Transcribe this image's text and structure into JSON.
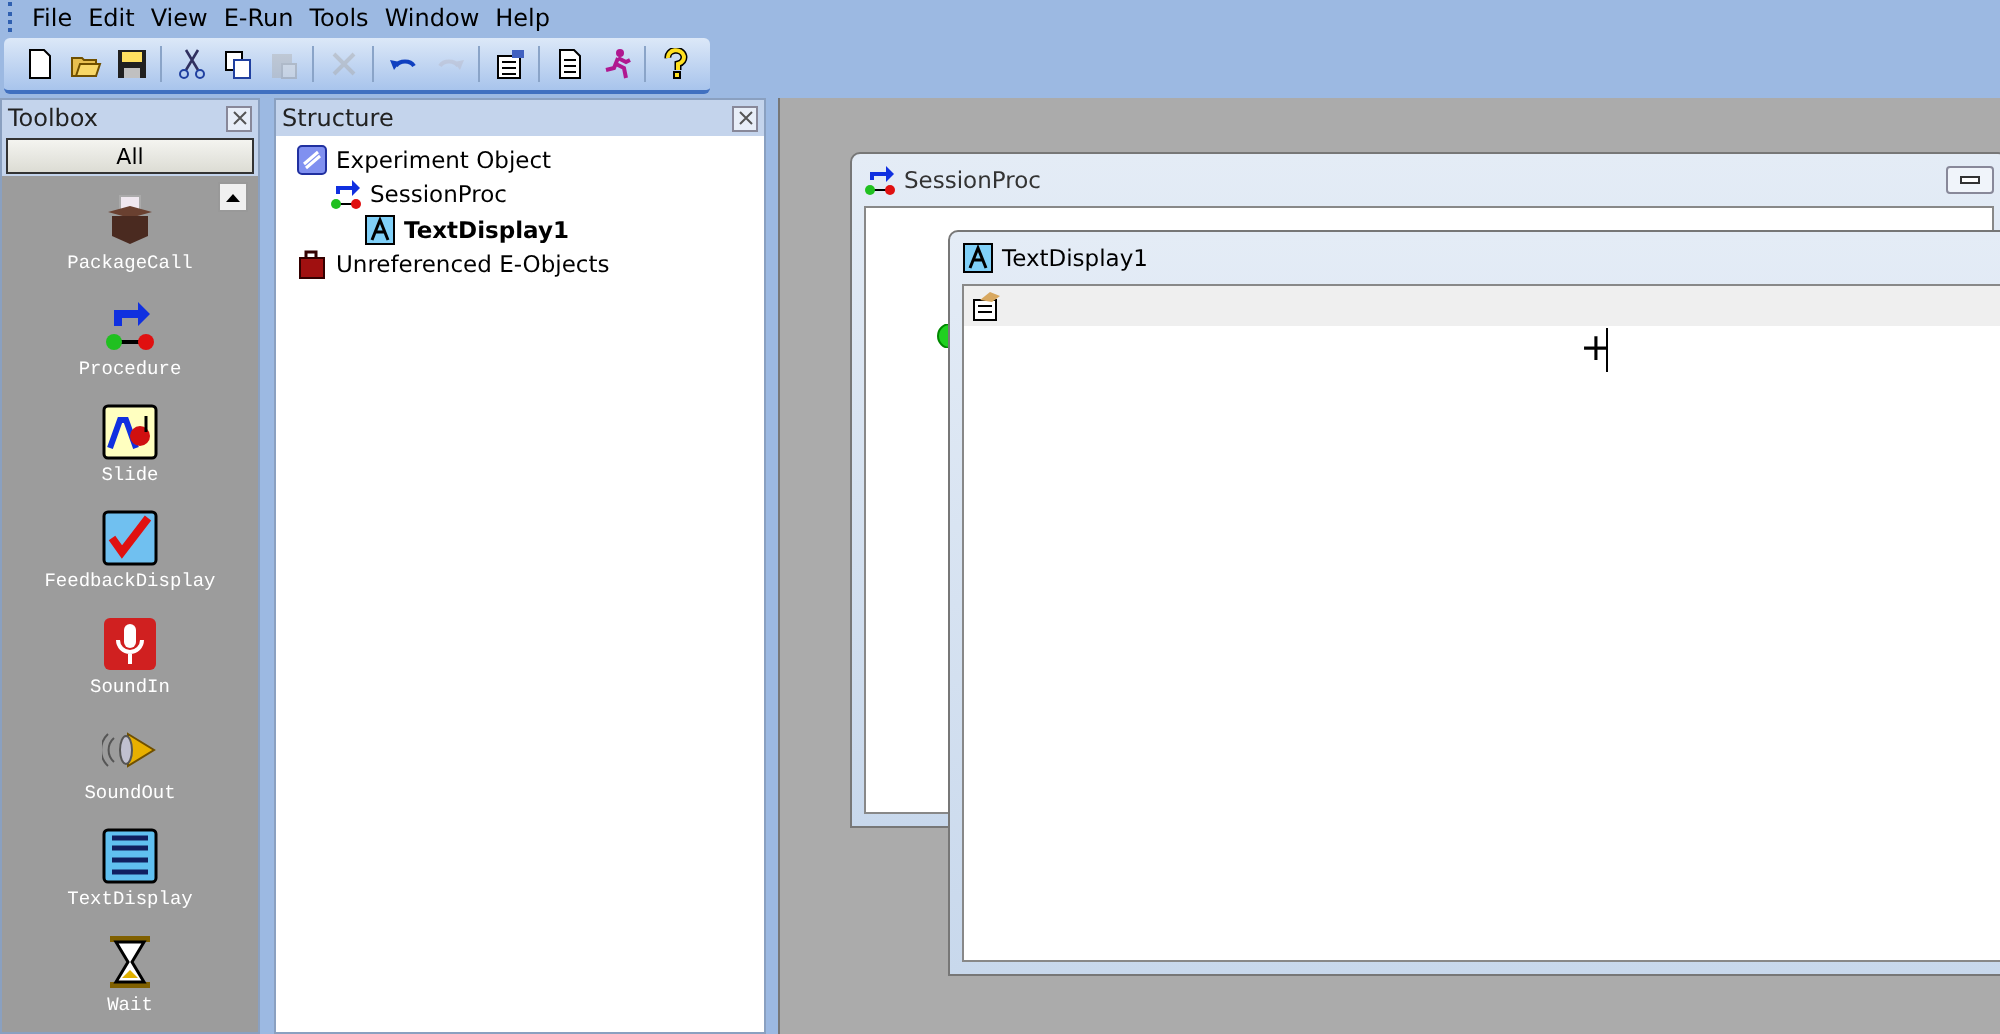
{
  "menu": [
    "File",
    "Edit",
    "View",
    "E-Run",
    "Tools",
    "Window",
    "Help"
  ],
  "toolbar": [
    [
      {
        "kind": "new",
        "disabled": false
      },
      {
        "kind": "open",
        "disabled": false
      },
      {
        "kind": "save",
        "disabled": false
      }
    ],
    [
      {
        "kind": "cut",
        "disabled": false
      },
      {
        "kind": "copy",
        "disabled": false
      },
      {
        "kind": "paste",
        "disabled": true
      }
    ],
    [
      {
        "kind": "delete",
        "disabled": true
      }
    ],
    [
      {
        "kind": "undo",
        "disabled": false
      },
      {
        "kind": "redo",
        "disabled": true
      }
    ],
    [
      {
        "kind": "properties",
        "disabled": false
      }
    ],
    [
      {
        "kind": "document",
        "disabled": false
      },
      {
        "kind": "run",
        "disabled": false
      }
    ],
    [
      {
        "kind": "help",
        "disabled": false
      }
    ]
  ],
  "toolbox": {
    "title": "Toolbox",
    "filter": "All",
    "items": [
      {
        "kind": "package",
        "label": "PackageCall"
      },
      {
        "kind": "procedure",
        "label": "Procedure"
      },
      {
        "kind": "slide",
        "label": "Slide"
      },
      {
        "kind": "feedback",
        "label": "FeedbackDisplay"
      },
      {
        "kind": "soundin",
        "label": "SoundIn"
      },
      {
        "kind": "soundout",
        "label": "SoundOut"
      },
      {
        "kind": "textdisplay",
        "label": "TextDisplay"
      },
      {
        "kind": "wait",
        "label": "Wait"
      }
    ]
  },
  "structure": {
    "title": "Structure",
    "tree": [
      {
        "kind": "experiment",
        "label": "Experiment Object",
        "selected": false,
        "children": [
          {
            "kind": "procedure",
            "label": "SessionProc",
            "selected": false,
            "children": [
              {
                "kind": "text",
                "label": "TextDisplay1",
                "selected": true
              }
            ]
          }
        ]
      },
      {
        "kind": "unreferenced",
        "label": "Unreferenced E-Objects",
        "selected": false
      }
    ]
  },
  "windows": [
    {
      "kind": "procedure",
      "title": "SessionProc"
    },
    {
      "kind": "text",
      "title": "TextDisplay1",
      "content": "+"
    }
  ]
}
